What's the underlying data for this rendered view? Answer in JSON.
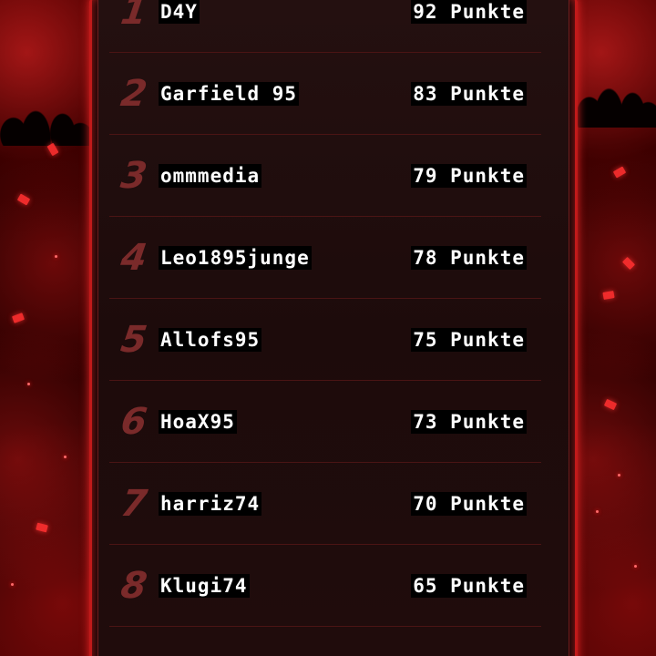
{
  "leaderboard": {
    "entries": [
      {
        "rank": "1",
        "name": "D4Y",
        "score": "92 Punkte"
      },
      {
        "rank": "2",
        "name": "Garfield 95",
        "score": "83 Punkte"
      },
      {
        "rank": "3",
        "name": "ommmedia",
        "score": "79 Punkte"
      },
      {
        "rank": "4",
        "name": "Leo1895junge",
        "score": "78 Punkte"
      },
      {
        "rank": "5",
        "name": "Allofs95",
        "score": "75 Punkte"
      },
      {
        "rank": "6",
        "name": "HoaX95",
        "score": "73 Punkte"
      },
      {
        "rank": "7",
        "name": "harriz74",
        "score": "70 Punkte"
      },
      {
        "rank": "8",
        "name": "Klugi74",
        "score": "65 Punkte"
      },
      {
        "rank": "",
        "name": "",
        "score": ""
      }
    ]
  },
  "colors": {
    "accent": "#c11a1a",
    "panel": "#1d0b0b",
    "rank_text": "#7a2a2a",
    "name_text": "#ffffff",
    "divider": "#4a1414"
  }
}
